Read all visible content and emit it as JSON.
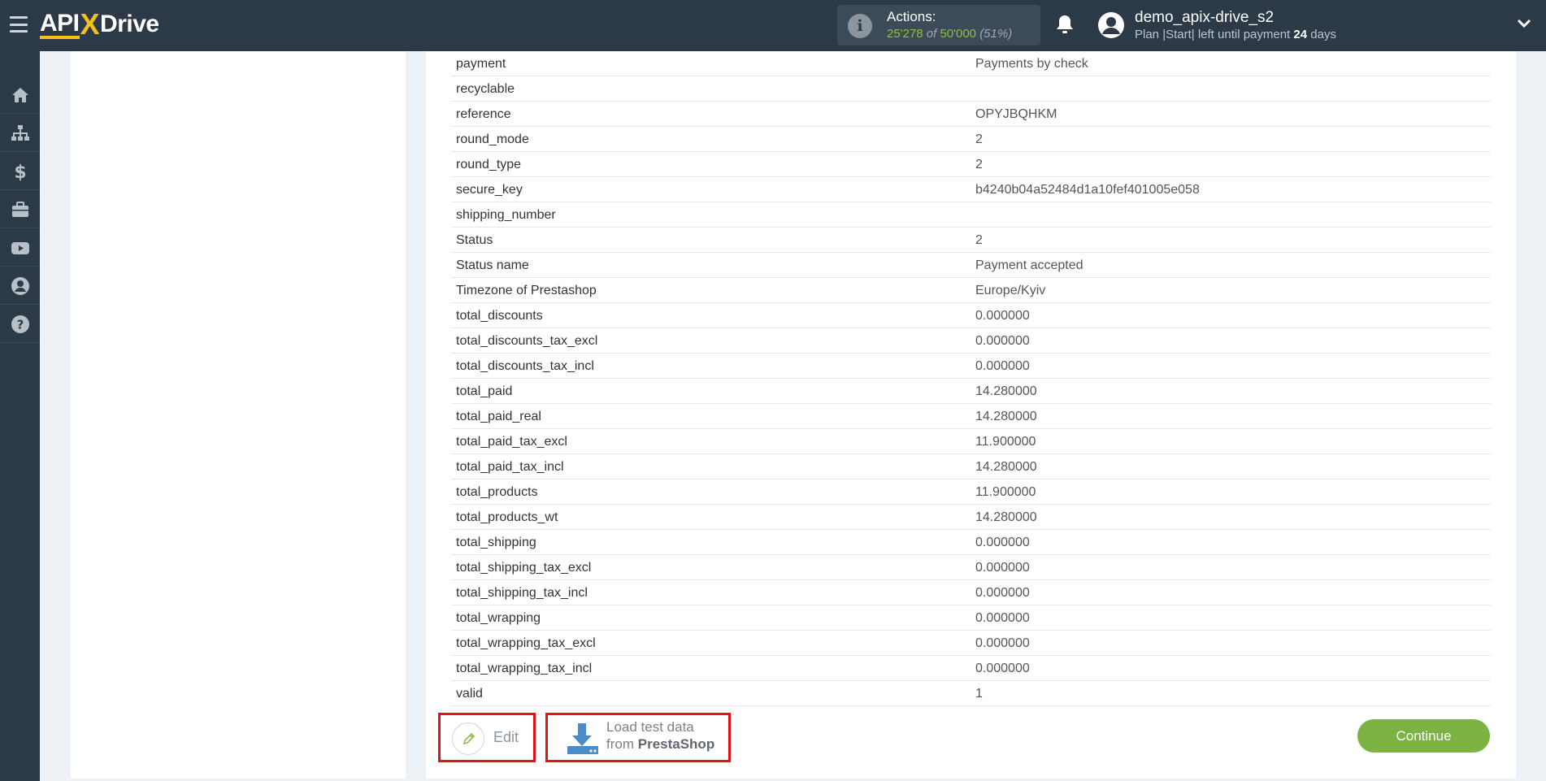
{
  "header": {
    "logo": {
      "api": "API",
      "x": "X",
      "drive": "Drive"
    },
    "actions": {
      "label": "Actions:",
      "used": "25'278",
      "of": "of",
      "total": "50'000",
      "percent": "(51%)"
    },
    "user": {
      "name": "demo_apix-drive_s2",
      "plan_prefix": "Plan |Start| left until payment",
      "days": "24",
      "days_suffix": "days"
    }
  },
  "sidebar": {
    "items": [
      {
        "icon": "home-icon"
      },
      {
        "icon": "sitemap-icon"
      },
      {
        "icon": "dollar-icon"
      },
      {
        "icon": "briefcase-icon"
      },
      {
        "icon": "youtube-icon"
      },
      {
        "icon": "user-circle-icon"
      },
      {
        "icon": "question-circle-icon"
      }
    ]
  },
  "table": {
    "rows": [
      {
        "key": "payment",
        "value": "Payments by check"
      },
      {
        "key": "recyclable",
        "value": ""
      },
      {
        "key": "reference",
        "value": "OPYJBQHKM"
      },
      {
        "key": "round_mode",
        "value": "2"
      },
      {
        "key": "round_type",
        "value": "2"
      },
      {
        "key": "secure_key",
        "value": "b4240b04a52484d1a10fef401005e058"
      },
      {
        "key": "shipping_number",
        "value": ""
      },
      {
        "key": "Status",
        "value": "2"
      },
      {
        "key": "Status name",
        "value": "Payment accepted"
      },
      {
        "key": "Timezone of Prestashop",
        "value": "Europe/Kyiv"
      },
      {
        "key": "total_discounts",
        "value": "0.000000"
      },
      {
        "key": "total_discounts_tax_excl",
        "value": "0.000000"
      },
      {
        "key": "total_discounts_tax_incl",
        "value": "0.000000"
      },
      {
        "key": "total_paid",
        "value": "14.280000"
      },
      {
        "key": "total_paid_real",
        "value": "14.280000"
      },
      {
        "key": "total_paid_tax_excl",
        "value": "11.900000"
      },
      {
        "key": "total_paid_tax_incl",
        "value": "14.280000"
      },
      {
        "key": "total_products",
        "value": "11.900000"
      },
      {
        "key": "total_products_wt",
        "value": "14.280000"
      },
      {
        "key": "total_shipping",
        "value": "0.000000"
      },
      {
        "key": "total_shipping_tax_excl",
        "value": "0.000000"
      },
      {
        "key": "total_shipping_tax_incl",
        "value": "0.000000"
      },
      {
        "key": "total_wrapping",
        "value": "0.000000"
      },
      {
        "key": "total_wrapping_tax_excl",
        "value": "0.000000"
      },
      {
        "key": "total_wrapping_tax_incl",
        "value": "0.000000"
      },
      {
        "key": "valid",
        "value": "1"
      }
    ]
  },
  "buttons": {
    "edit": "Edit",
    "load_line1": "Load test data",
    "load_line2_prefix": "from",
    "load_line2_brand": "PrestaShop",
    "continue": "Continue"
  },
  "colors": {
    "topbar": "#2c3a47",
    "accent_yellow": "#f2c21a",
    "accent_green": "#7cb342",
    "highlight_red": "#e0121c"
  }
}
